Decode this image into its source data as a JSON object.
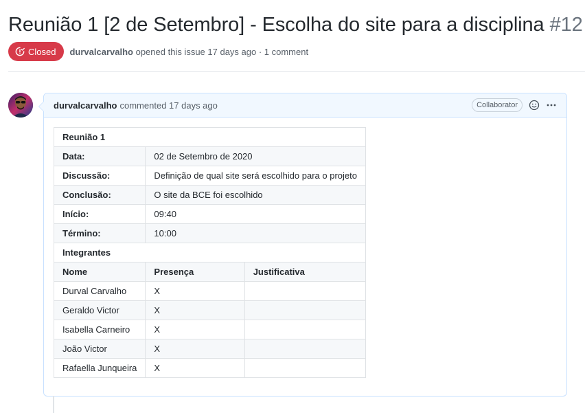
{
  "issue": {
    "title": "Reunião 1 [2 de Setembro] - Escolha do site para a disciplina",
    "number": "#12",
    "state": "Closed",
    "author": "durvalcarvalho",
    "opened_text": "opened this issue 17 days ago · 1 comment",
    "state_color": "#d73a49"
  },
  "comment": {
    "author": "durvalcarvalho",
    "time_text": "commented 17 days ago",
    "role": "Collaborator",
    "reaction_icon": "smiley-icon",
    "menu_icon": "kebab-horizontal-icon"
  },
  "meeting_table": {
    "heading": "Reunião 1",
    "fields": [
      {
        "label": "Data:",
        "value": "02 de Setembro de 2020"
      },
      {
        "label": "Discussão:",
        "value": "Definição de qual site será escolhido para o projeto"
      },
      {
        "label": "Conclusão:",
        "value": "O site da BCE foi escolhido"
      },
      {
        "label": "Início:",
        "value": "09:40"
      },
      {
        "label": "Término:",
        "value": "10:00"
      }
    ],
    "members_heading": "Integrantes",
    "columns": [
      "Nome",
      "Presença",
      "Justificativa"
    ],
    "members": [
      {
        "name": "Durval Carvalho",
        "presence": "X",
        "justification": ""
      },
      {
        "name": "Geraldo Victor",
        "presence": "X",
        "justification": ""
      },
      {
        "name": "Isabella Carneiro",
        "presence": "X",
        "justification": ""
      },
      {
        "name": "João Victor",
        "presence": "X",
        "justification": ""
      },
      {
        "name": "Rafaella Junqueira",
        "presence": "X",
        "justification": ""
      }
    ]
  }
}
